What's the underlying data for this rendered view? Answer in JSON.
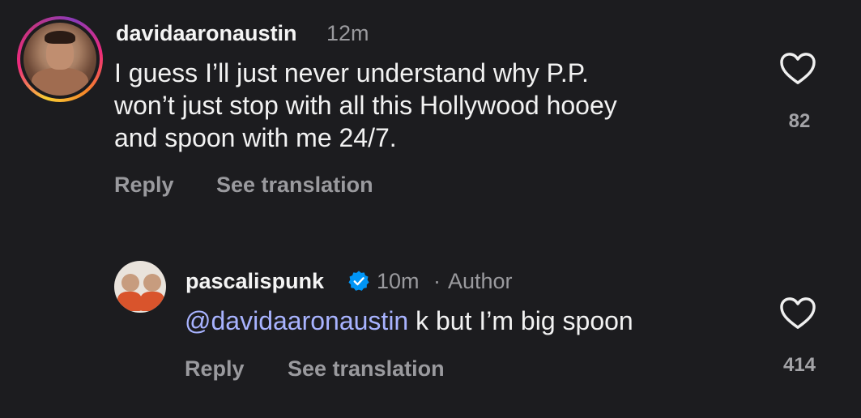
{
  "comments": [
    {
      "username": "davidaaronaustin",
      "time": "12m",
      "text_lines": [
        "I guess I’ll just never understand why P.P.",
        "won’t just stop with all this Hollywood hooey",
        "and spoon with me 24/7."
      ],
      "reply_label": "Reply",
      "translate_label": "See translation",
      "likes": "82"
    },
    {
      "username": "pascalispunk",
      "time": "10m",
      "meta_separator": "·",
      "role": "Author",
      "mention": "@davidaaronaustin",
      "text": " k but I’m big spoon",
      "reply_label": "Reply",
      "translate_label": "See translation",
      "likes": "414"
    }
  ],
  "colors": {
    "background": "#1c1c1f",
    "mention": "#a8b3ff",
    "verified": "#0095f6",
    "muted": "#9a9a9e"
  },
  "icons": {
    "like": "heart-outline-icon",
    "verified": "verified-badge-icon"
  }
}
